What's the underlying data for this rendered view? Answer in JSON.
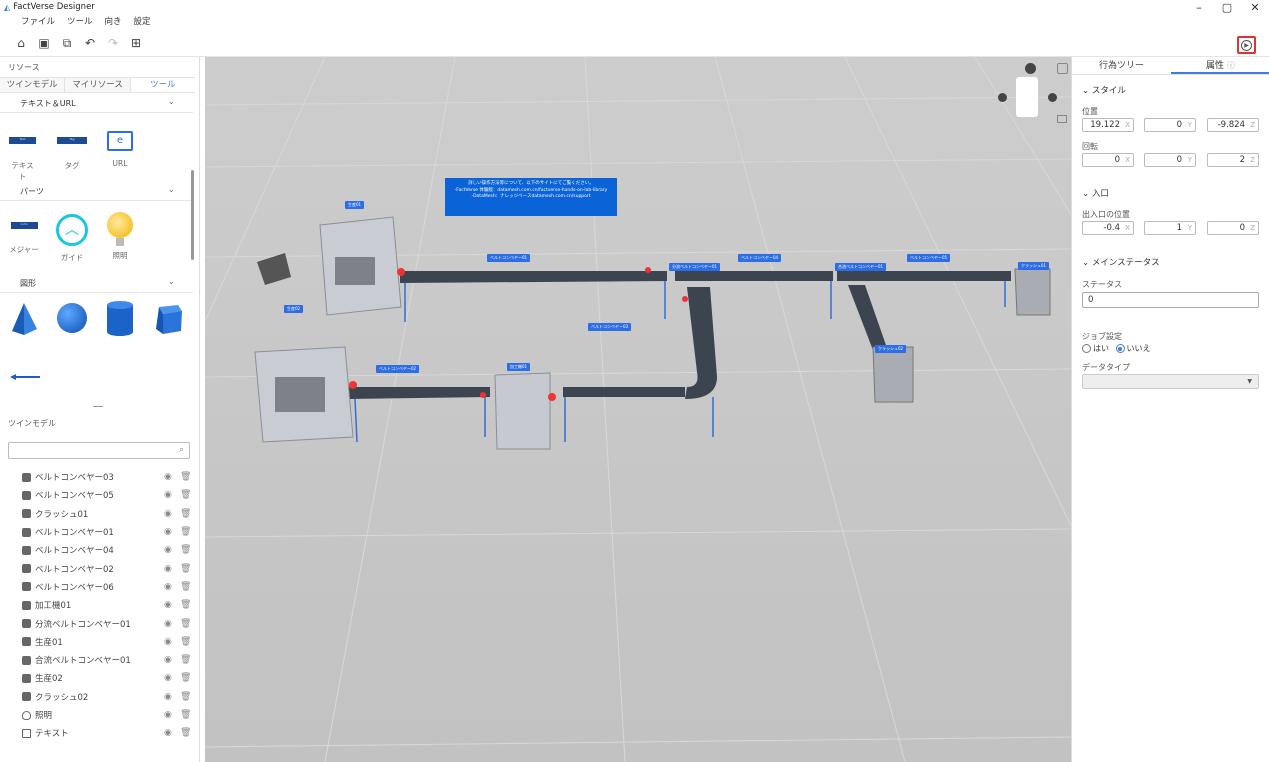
{
  "app": {
    "title": "FactVerse Designer"
  },
  "window": {
    "minimize": "–",
    "restore": "▢",
    "close": "✕"
  },
  "menu": [
    "ファイル",
    "ツール",
    "向き",
    "設定"
  ],
  "toolbar": {
    "icons": [
      "home-icon",
      "save-icon",
      "save-as-icon",
      "undo-icon",
      "redo-icon",
      "scene-icon"
    ]
  },
  "left": {
    "resources_title": "リソース",
    "tabs": [
      "ツインモデル",
      "マイリソース",
      "ツール"
    ],
    "sections": {
      "text_url": {
        "title": "テキスト＆URL",
        "items": [
          "テキスト",
          "タグ",
          "URL"
        ]
      },
      "parts": {
        "title": "パーツ",
        "items": [
          "メジャー",
          "ガイド",
          "照明"
        ]
      },
      "shapes": {
        "title": "図形"
      }
    },
    "tile_text": {
      "text": "Text",
      "tag": "Tag",
      "measure": "1.2m"
    },
    "twin_title": "ツインモデル",
    "search_placeholder": "",
    "tree": [
      "ベルトコンベヤー03",
      "ベルトコンベヤー05",
      "クラッシュ01",
      "ベルトコンベヤー01",
      "ベルトコンベヤー04",
      "ベルトコンベヤー02",
      "ベルトコンベヤー06",
      "加工機01",
      "分流ベルトコンベヤー01",
      "生産01",
      "合流ベルトコンベヤー01",
      "生産02",
      "クラッシュ02",
      "照明",
      "テキスト"
    ]
  },
  "canvas": {
    "info": "詳しい操作方法等について、以下のサイトにてご覧ください。\n-FactVerse 体験版：datamesh.com.cn/factverse-hands-on-lab-library\n-DataMesh：ナレッジベースdatamesh.com.cn/support",
    "labels": [
      "生産01",
      "生産02",
      "ベルトコンベヤー01",
      "ベルトコンベヤー02",
      "ベルトコンベヤー03",
      "加工機01",
      "分流ベルトコンベヤー01",
      "ベルトコンベヤー04",
      "合流ベルトコンベヤー01",
      "ベルトコンベヤー05",
      "クラッシュ01",
      "クラッシュ02"
    ]
  },
  "right": {
    "tabs": [
      "行為ツリー",
      "属性"
    ],
    "style": "スタイル",
    "position_label": "位置",
    "position": {
      "x": "19.122",
      "y": "0",
      "z": "-9.824"
    },
    "rotation_label": "回転",
    "rotation": {
      "x": "0",
      "y": "0",
      "z": "2"
    },
    "entry": "入口",
    "entry_pos_label": "出入口の位置",
    "entry_pos": {
      "x": "-0.4",
      "y": "1",
      "z": "0"
    },
    "main_status": "メインステータス",
    "status_label": "ステータス",
    "status_value": "0",
    "job_label": "ジョブ設定",
    "yes": "はい",
    "no": "いいえ",
    "datatype_label": "データタイプ"
  }
}
